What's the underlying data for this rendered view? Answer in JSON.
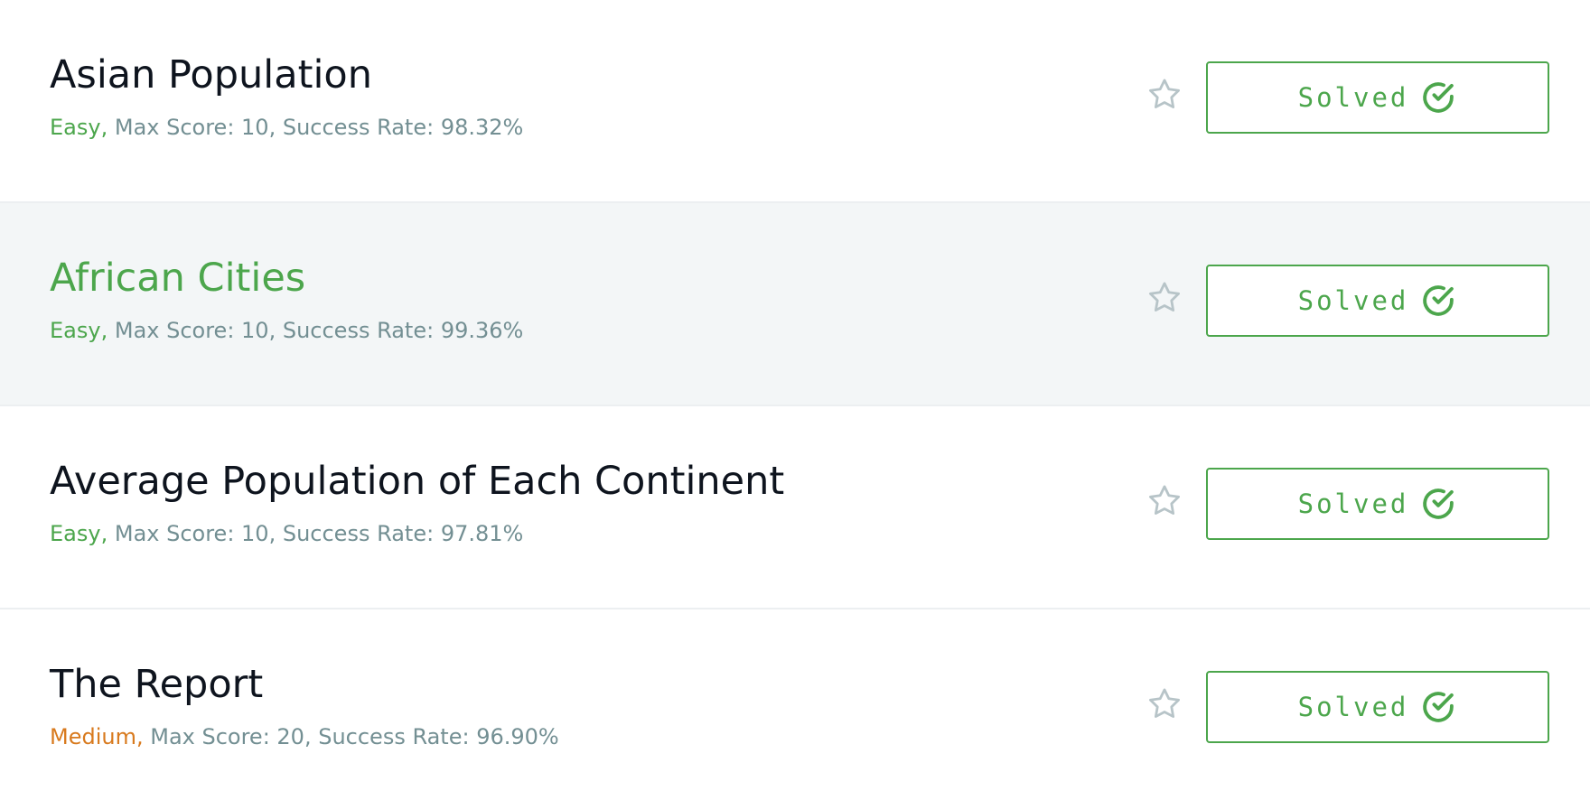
{
  "colors": {
    "accent_green": "#4ca64c",
    "medium_orange": "#d87a1e",
    "meta_gray": "#738f93",
    "hover_row_bg": "#f3f6f7"
  },
  "challenges": [
    {
      "title": "Asian Population",
      "difficulty": "Easy,",
      "difficulty_level": "easy",
      "details": "Max Score: 10, Success Rate: 98.32%",
      "status_label": "Solved",
      "star_icon": "star-outline-icon",
      "status_icon": "check-circle-icon"
    },
    {
      "title": "African Cities",
      "difficulty": "Easy,",
      "difficulty_level": "easy",
      "details": "Max Score: 10, Success Rate: 99.36%",
      "status_label": "Solved",
      "star_icon": "star-outline-icon",
      "status_icon": "check-circle-icon",
      "hovered": true
    },
    {
      "title": "Average Population of Each Continent",
      "difficulty": "Easy,",
      "difficulty_level": "easy",
      "details": "Max Score: 10, Success Rate: 97.81%",
      "status_label": "Solved",
      "star_icon": "star-outline-icon",
      "status_icon": "check-circle-icon"
    },
    {
      "title": "The Report",
      "difficulty": "Medium,",
      "difficulty_level": "medium",
      "details": "Max Score: 20, Success Rate: 96.90%",
      "status_label": "Solved",
      "star_icon": "star-outline-icon",
      "status_icon": "check-circle-icon"
    }
  ]
}
